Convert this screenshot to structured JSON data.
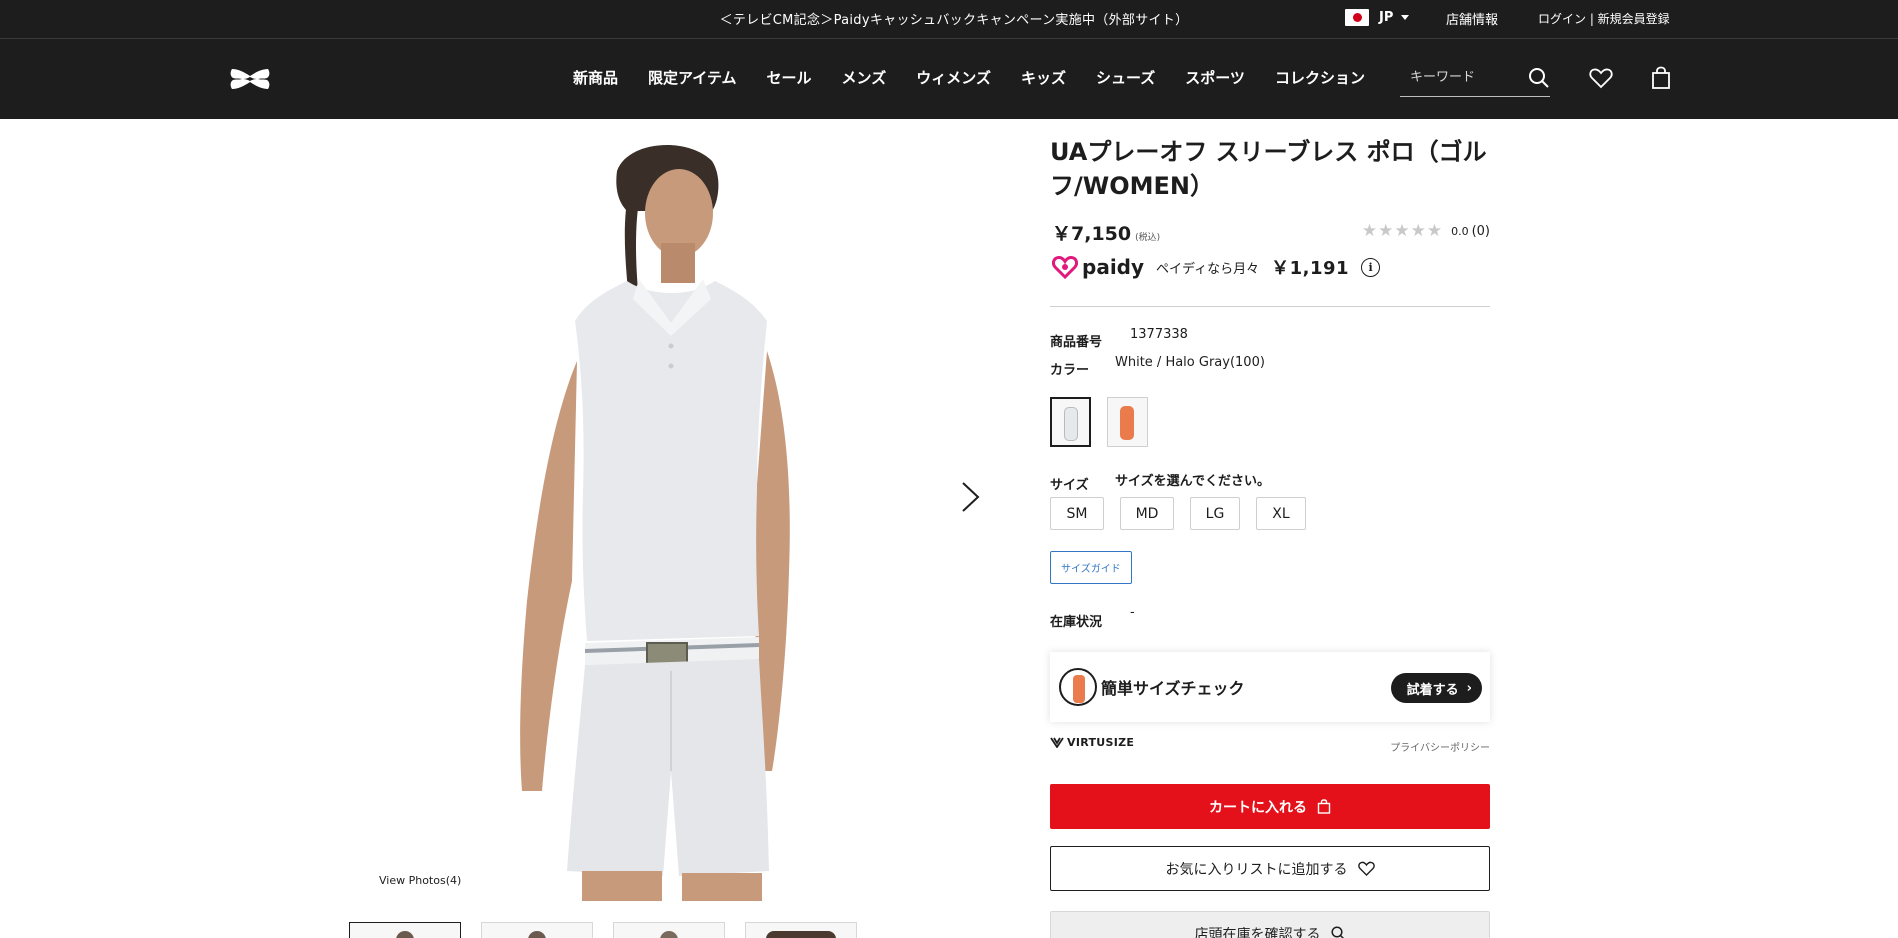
{
  "topbar": {
    "promo": "＜テレビCM記念＞Paidyキャッシュバックキャンペーン実施中（外部サイト）",
    "locale": "JP",
    "store_info": "店舗情報",
    "login": "ログイン | 新規会員登録"
  },
  "nav": {
    "items": [
      "新商品",
      "限定アイテム",
      "セール",
      "メンズ",
      "ウィメンズ",
      "キッズ",
      "シューズ",
      "スポーツ",
      "コレクション"
    ],
    "search_placeholder": "キーワード"
  },
  "gallery": {
    "view_photos": "View Photos(4)"
  },
  "product": {
    "title": "UAプレーオフ スリーブレス ポロ（ゴルフ/WOMEN）",
    "price": "￥7,150",
    "tax_note": "(税込)",
    "rating_score": "0.0",
    "rating_count": "(0)",
    "rating_stars": 0,
    "paidy_brand": "paidy",
    "paidy_text": "ペイディなら月々",
    "paidy_amount": "￥1,191",
    "sku_label": "商品番号",
    "sku": "1377338",
    "color_label": "カラー",
    "color": "White / Halo Gray(100)",
    "size_label": "サイズ",
    "size_hint": "サイズを選んでください。",
    "sizes": [
      "SM",
      "MD",
      "LG",
      "XL"
    ],
    "size_guide": "サイズガイド",
    "stock_label": "在庫状況",
    "stock_value": "-"
  },
  "virtusize": {
    "title": "簡単サイズチェック",
    "button": "試着する",
    "brand": "VIRTUSIZE",
    "privacy": "プライバシーポリシー"
  },
  "actions": {
    "add_to_cart": "カートに入れる",
    "add_to_wishlist": "お気に入りリストに追加する",
    "check_store": "店頭在庫を確認する"
  },
  "colors": {
    "header_bg": "#1d1d1d",
    "cart_red": "#e4111a",
    "guide_blue": "#3277c4",
    "paidy_pink": "#e0197d",
    "swatch_white": "#e6e8eb",
    "swatch_orange": "#e97b4c"
  }
}
